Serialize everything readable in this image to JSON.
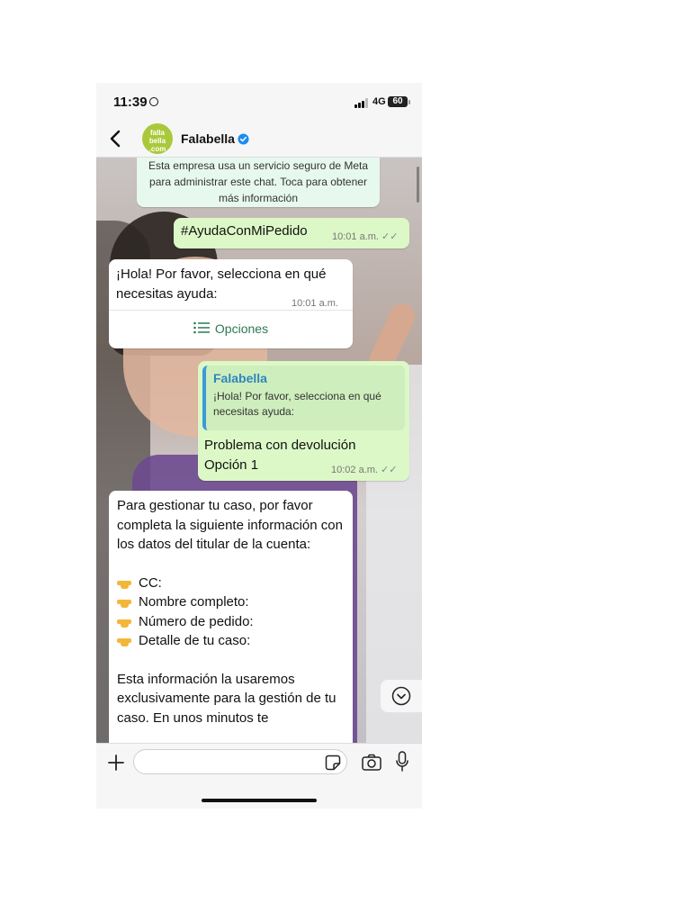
{
  "status_bar": {
    "time": "11:39",
    "network": "4G",
    "battery": "60"
  },
  "header": {
    "contact_name": "Falabella",
    "avatar_text": [
      "falla",
      "bella",
      ".com"
    ],
    "verified": true
  },
  "chat": {
    "system_notice": "Esta empresa usa un servicio seguro de Meta para administrar este chat. Toca para obtener más información",
    "messages": [
      {
        "direction": "outgoing",
        "text": "#AyudaConMiPedido",
        "time": "10:01 a.m.",
        "status": "read"
      },
      {
        "direction": "incoming",
        "text": "¡Hola! Por favor, selecciona en qué necesitas ayuda:",
        "time": "10:01 a.m.",
        "button": "Opciones"
      },
      {
        "direction": "outgoing",
        "quote_author": "Falabella",
        "quote_text": "¡Hola! Por favor, selecciona en qué necesitas ayuda:",
        "text": "Problema con devolución Opción 1",
        "time": "10:02 a.m.",
        "status": "read"
      },
      {
        "direction": "incoming",
        "intro": "Para gestionar tu caso, por favor completa la siguiente información con los datos del titular de la cuenta:",
        "fields": [
          "CC:",
          "Nombre completo:",
          "Número de pedido:",
          "Detalle de tu caso:"
        ],
        "outro": "Esta información la usaremos exclusivamente para la gestión de tu caso. En unos minutos te"
      }
    ]
  },
  "input_bar": {
    "placeholder": ""
  },
  "colors": {
    "outgoing_bubble": "#dcf8c6",
    "incoming_bubble": "#ffffff",
    "notice_bubble": "#e7f8ee",
    "accent_green": "#2b7a53",
    "verified_blue": "#1d8cf0",
    "brand_avatar": "#a9c93a"
  }
}
